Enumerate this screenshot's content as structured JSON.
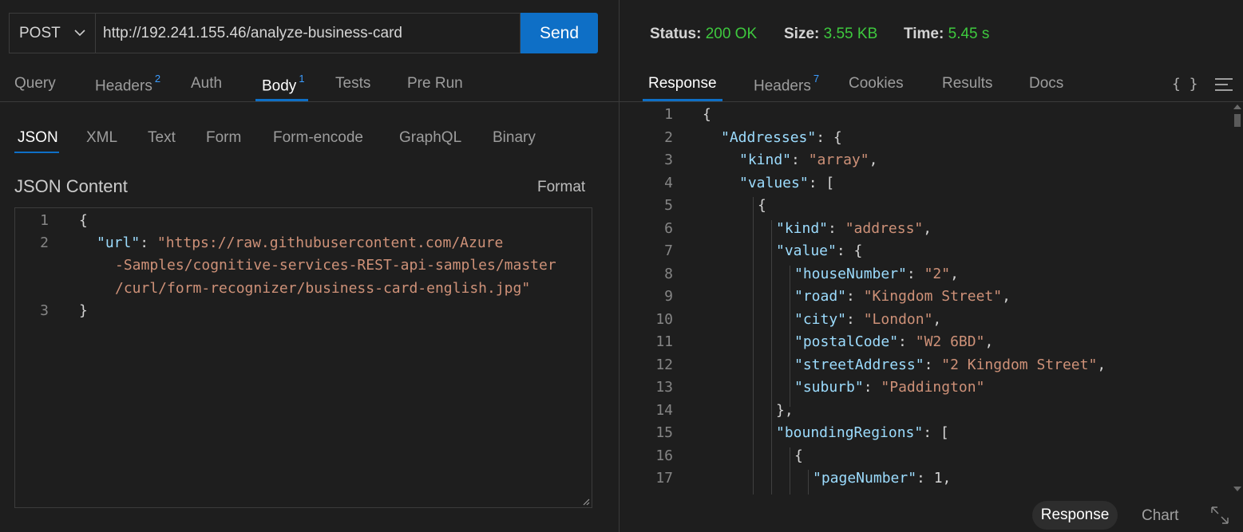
{
  "request": {
    "method": "POST",
    "url": "http://192.241.155.46/analyze-business-card",
    "send_label": "Send"
  },
  "request_tabs": [
    {
      "label": "Query",
      "badge": ""
    },
    {
      "label": "Headers",
      "badge": "2"
    },
    {
      "label": "Auth",
      "badge": ""
    },
    {
      "label": "Body",
      "badge": "1"
    },
    {
      "label": "Tests",
      "badge": ""
    },
    {
      "label": "Pre Run",
      "badge": ""
    }
  ],
  "body_tabs": [
    "JSON",
    "XML",
    "Text",
    "Form",
    "Form-encode",
    "GraphQL",
    "Binary"
  ],
  "body_section": {
    "title": "JSON Content",
    "format_label": "Format"
  },
  "editor": {
    "line_numbers": [
      "1",
      "2",
      "3"
    ],
    "open_brace": "{",
    "key": "\"url\"",
    "colon": ": ",
    "value_line1": "\"https://raw.githubusercontent.com/Azure",
    "value_line2": "-Samples/cognitive-services-REST-api-samples/master",
    "value_line3": "/curl/form-recognizer/business-card-english.jpg\"",
    "close_brace": "}"
  },
  "response_status": {
    "status_label": "Status:",
    "status_value": "200 OK",
    "size_label": "Size:",
    "size_value": "3.55 KB",
    "time_label": "Time:",
    "time_value": "5.45 s"
  },
  "response_tabs": [
    {
      "label": "Response",
      "badge": ""
    },
    {
      "label": "Headers",
      "badge": "7"
    },
    {
      "label": "Cookies",
      "badge": ""
    },
    {
      "label": "Results",
      "badge": ""
    },
    {
      "label": "Docs",
      "badge": ""
    }
  ],
  "response_toolbar": {
    "braces_icon": "{ }",
    "menu_icon": "menu-icon"
  },
  "response_lines": [
    {
      "n": "1",
      "indent": 0,
      "parts": [
        [
          "p",
          "{"
        ]
      ]
    },
    {
      "n": "2",
      "indent": 1,
      "parts": [
        [
          "k",
          "\"Addresses\""
        ],
        [
          "p",
          ": {"
        ]
      ]
    },
    {
      "n": "3",
      "indent": 2,
      "parts": [
        [
          "k",
          "\"kind\""
        ],
        [
          "p",
          ": "
        ],
        [
          "s",
          "\"array\""
        ],
        [
          "p",
          ","
        ]
      ]
    },
    {
      "n": "4",
      "indent": 2,
      "parts": [
        [
          "k",
          "\"values\""
        ],
        [
          "p",
          ": ["
        ]
      ]
    },
    {
      "n": "5",
      "indent": 3,
      "parts": [
        [
          "p",
          "{"
        ]
      ]
    },
    {
      "n": "6",
      "indent": 4,
      "parts": [
        [
          "k",
          "\"kind\""
        ],
        [
          "p",
          ": "
        ],
        [
          "s",
          "\"address\""
        ],
        [
          "p",
          ","
        ]
      ]
    },
    {
      "n": "7",
      "indent": 4,
      "parts": [
        [
          "k",
          "\"value\""
        ],
        [
          "p",
          ": {"
        ]
      ]
    },
    {
      "n": "8",
      "indent": 5,
      "parts": [
        [
          "k",
          "\"houseNumber\""
        ],
        [
          "p",
          ": "
        ],
        [
          "s",
          "\"2\""
        ],
        [
          "p",
          ","
        ]
      ]
    },
    {
      "n": "9",
      "indent": 5,
      "parts": [
        [
          "k",
          "\"road\""
        ],
        [
          "p",
          ": "
        ],
        [
          "s",
          "\"Kingdom Street\""
        ],
        [
          "p",
          ","
        ]
      ]
    },
    {
      "n": "10",
      "indent": 5,
      "parts": [
        [
          "k",
          "\"city\""
        ],
        [
          "p",
          ": "
        ],
        [
          "s",
          "\"London\""
        ],
        [
          "p",
          ","
        ]
      ]
    },
    {
      "n": "11",
      "indent": 5,
      "parts": [
        [
          "k",
          "\"postalCode\""
        ],
        [
          "p",
          ": "
        ],
        [
          "s",
          "\"W2 6BD\""
        ],
        [
          "p",
          ","
        ]
      ]
    },
    {
      "n": "12",
      "indent": 5,
      "parts": [
        [
          "k",
          "\"streetAddress\""
        ],
        [
          "p",
          ": "
        ],
        [
          "s",
          "\"2 Kingdom Street\""
        ],
        [
          "p",
          ","
        ]
      ]
    },
    {
      "n": "13",
      "indent": 5,
      "parts": [
        [
          "k",
          "\"suburb\""
        ],
        [
          "p",
          ": "
        ],
        [
          "s",
          "\"Paddington\""
        ]
      ]
    },
    {
      "n": "14",
      "indent": 4,
      "parts": [
        [
          "p",
          "},"
        ]
      ]
    },
    {
      "n": "15",
      "indent": 4,
      "parts": [
        [
          "k",
          "\"boundingRegions\""
        ],
        [
          "p",
          ": ["
        ]
      ]
    },
    {
      "n": "16",
      "indent": 5,
      "parts": [
        [
          "p",
          "{"
        ]
      ]
    },
    {
      "n": "17",
      "indent": 6,
      "parts": [
        [
          "k",
          "\"pageNumber\""
        ],
        [
          "p",
          ": 1,"
        ]
      ]
    }
  ],
  "bottom_bar": {
    "response_label": "Response",
    "chart_label": "Chart",
    "expand_icon": "expand-icon"
  },
  "colors": {
    "accent": "#0e6fc6",
    "status_ok": "#3ec93e",
    "json_key": "#9cdcfe",
    "json_string": "#ce9178"
  }
}
